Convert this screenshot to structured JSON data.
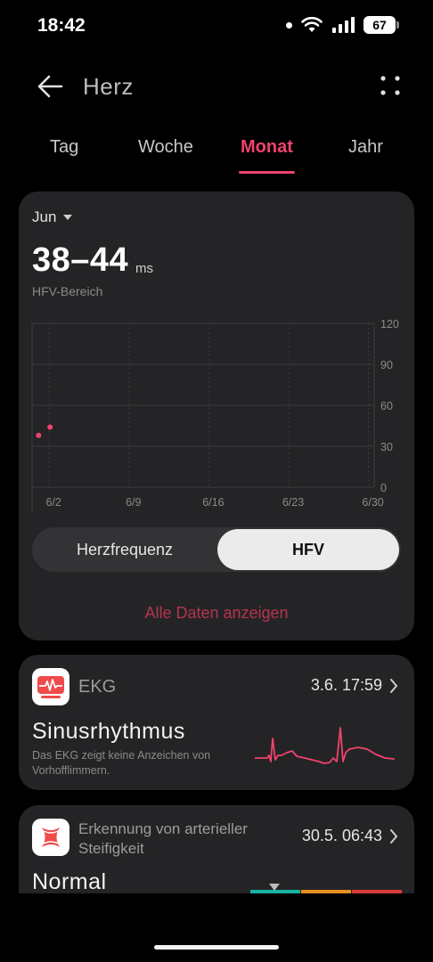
{
  "status_bar": {
    "time": "18:42",
    "battery": "67"
  },
  "header": {
    "title": "Herz"
  },
  "tabs": [
    {
      "label": "Tag",
      "active": false
    },
    {
      "label": "Woche",
      "active": false
    },
    {
      "label": "Monat",
      "active": true
    },
    {
      "label": "Jahr",
      "active": false
    }
  ],
  "hrv_card": {
    "month": "Jun",
    "range_value": "38–44",
    "range_unit": "ms",
    "range_label": "HFV-Bereich",
    "toggle": {
      "option_a": "Herzfrequenz",
      "option_b": "HFV",
      "selected": "HFV"
    },
    "all_data_link": "Alle Daten anzeigen"
  },
  "chart_data": {
    "type": "scatter",
    "x_ticks": [
      "6/2",
      "6/9",
      "6/16",
      "6/23",
      "6/30"
    ],
    "y_ticks": [
      0,
      30,
      60,
      90,
      120
    ],
    "ylim": [
      0,
      120
    ],
    "points": [
      {
        "x": 1,
        "y": 38
      },
      {
        "x": 2,
        "y": 44
      }
    ],
    "color": "#f0436c"
  },
  "ekg_card": {
    "title": "EKG",
    "datetime": "3.6. 17:59",
    "result": "Sinusrhythmus",
    "description": "Das EKG zeigt keine Anzeichen von Vorhofflimmern."
  },
  "stiffness_card": {
    "title": "Erkennung von arterieller Steifigkeit",
    "datetime": "30.5. 06:43",
    "result": "Normal"
  },
  "colors": {
    "accent": "#f0436c",
    "card_bg": "#242426",
    "background": "#000000"
  }
}
